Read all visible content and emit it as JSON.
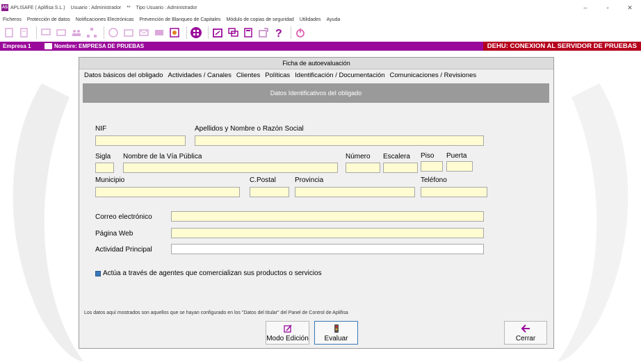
{
  "window": {
    "title_parts": [
      "APLISAFE ( Aplifisa S.L.)",
      "Usuario : Administrador",
      "**",
      "Tipo Usuario : Administrador"
    ],
    "logo": "AS",
    "controls": [
      "–",
      "▫",
      "✕"
    ]
  },
  "menu": [
    "Ficheros",
    "Protección de datos",
    "Notificaciones Electrónicas",
    "Prevención de Blanqueo de Capitales",
    "Módulo de copias de seguridad",
    "Utilidades",
    "Ayuda"
  ],
  "status": {
    "empresa": "Empresa 1",
    "nombre": "Nombre: EMPRESA DE PRUEBAS",
    "dehu": "DEHU: CONEXION AL SERVIDOR DE PRUEBAS"
  },
  "dialog": {
    "title": "Ficha de autoevaluación",
    "tabs": [
      "Datos básicos del obligado",
      "Actividades / Canales",
      "Clientes",
      "Políticas",
      "Identificación / Documentación",
      "Comunicaciones / Revisiones"
    ],
    "section": "Datos Identificativos del obligado",
    "labels": {
      "nif": "NIF",
      "apellidos": "Apellidos y Nombre o Razón Social",
      "sigla": "Sigla",
      "via": "Nombre de la Vía Pública",
      "numero": "Número",
      "escalera": "Escalera",
      "piso": "Piso",
      "puerta": "Puerta",
      "municipio": "Municipio",
      "cpostal": "C.Postal",
      "provincia": "Provincia",
      "telefono": "Teléfono",
      "correo": "Correo electrónico",
      "web": "Página Web",
      "actividad": "Actividad Principal"
    },
    "checkbox": "Actúa a través de agentes que comercializan sus productos o servicios",
    "note": "Los datos aquí mostrados son aquellos que se hayan configurado en los \"Datos del titular\" del Panel de Control de Aplifisa",
    "buttons": {
      "modo": "Modo Edición",
      "evaluar": "Evaluar",
      "cerrar": "Cerrar"
    }
  },
  "colors": {
    "accent": "#9a0a9a",
    "dehu": "#b5001c",
    "field": "#fffbd2"
  }
}
